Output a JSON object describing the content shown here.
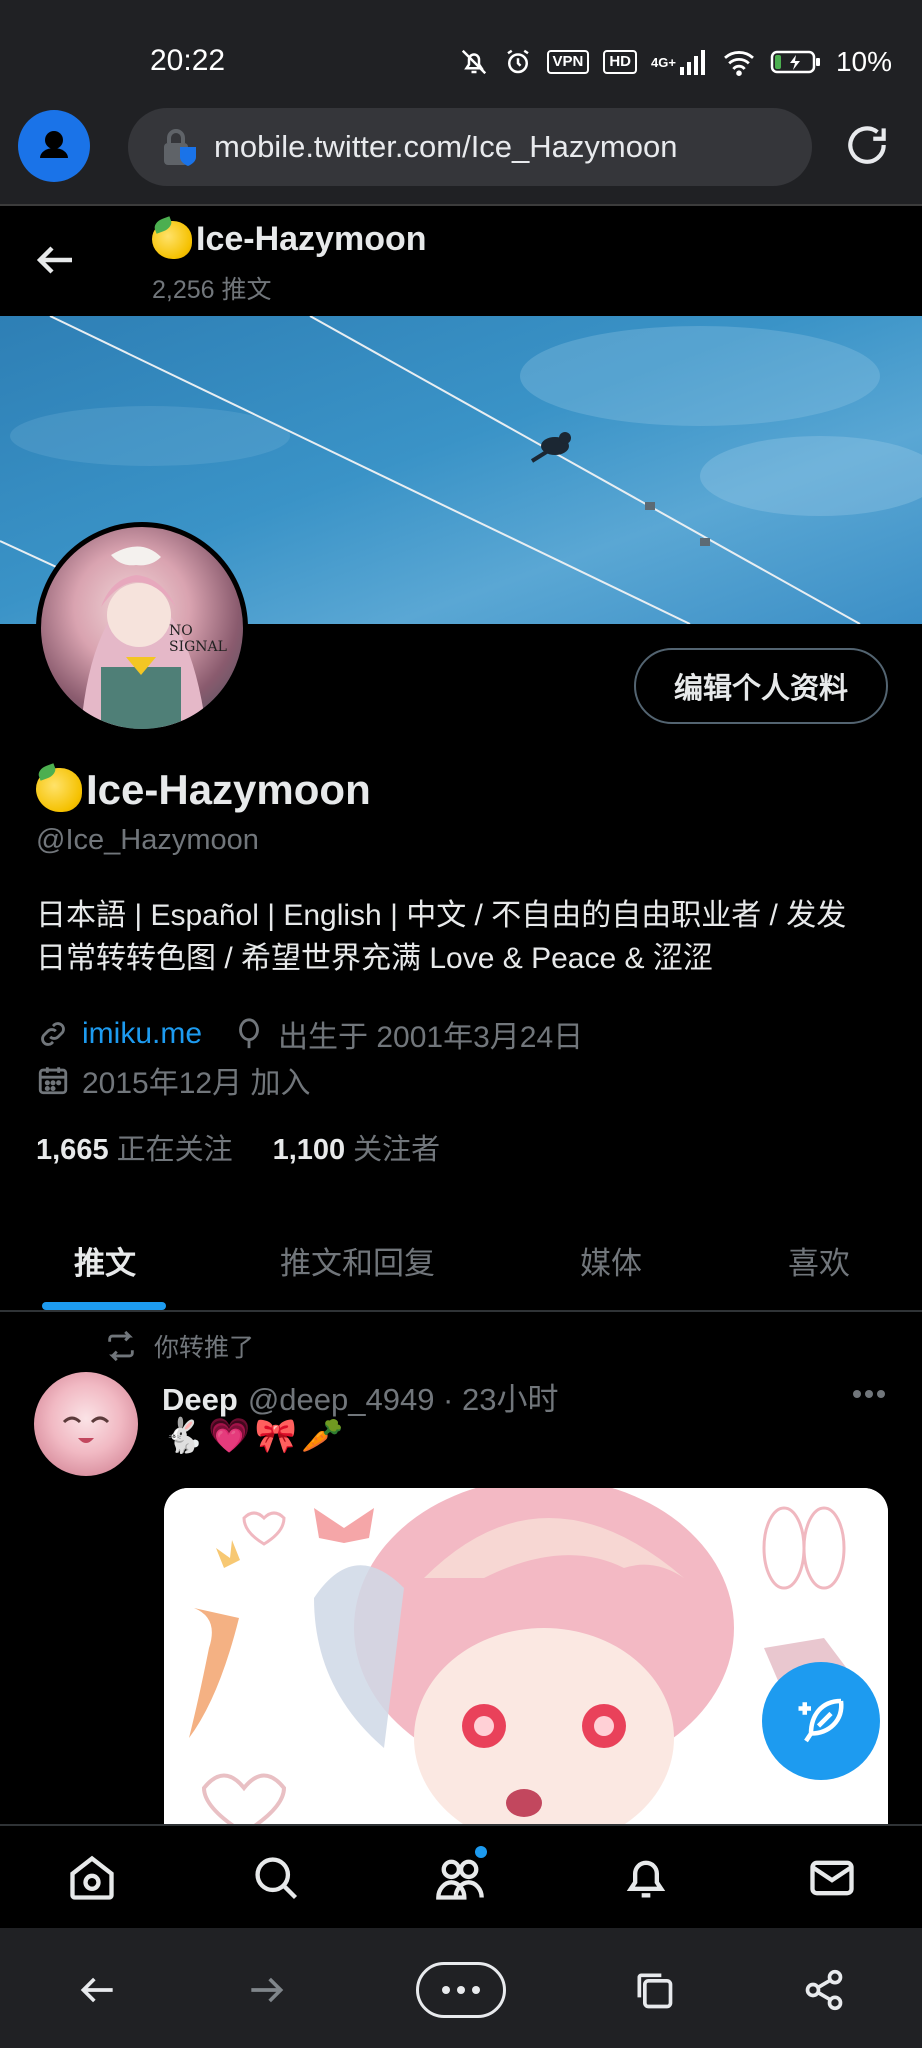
{
  "status_bar": {
    "time": "20:22",
    "vpn": "VPN",
    "hd": "HD",
    "network": "4G+",
    "battery": "10%",
    "icons": [
      "mute-icon",
      "alarm-icon",
      "vpn-icon",
      "hd-icon",
      "signal-icon",
      "wifi-icon",
      "battery-icon"
    ]
  },
  "browser": {
    "url": "mobile.twitter.com/Ice_Hazymoon",
    "icons": [
      "account-icon",
      "lock-icon",
      "reload-icon"
    ]
  },
  "header": {
    "name": "Ice-Hazymoon",
    "tweet_count": "2,256 推文"
  },
  "profile": {
    "edit_button": "编辑个人资料",
    "avatar_text": "NO SIGNAL",
    "name": "Ice-Hazymoon",
    "handle": "@Ice_Hazymoon",
    "bio_line1": "日本語 | Español | English | 中文 / 不自由的自由职业者 / 发发",
    "bio_line2": "日常转转色图 / 希望世界充满 Love & Peace & 涩涩",
    "website": "imiku.me",
    "birthday": "出生于 2001年3月24日",
    "joined": "2015年12月 加入",
    "following_count": "1,665",
    "following_label": "正在关注",
    "followers_count": "1,100",
    "followers_label": "关注者"
  },
  "tabs": [
    {
      "label": "推文",
      "active": true
    },
    {
      "label": "推文和回复",
      "active": false
    },
    {
      "label": "媒体",
      "active": false
    },
    {
      "label": "喜欢",
      "active": false
    }
  ],
  "tweet": {
    "retweet_label": "你转推了",
    "author_name": "Deep",
    "author_meta": "@deep_4949 · 23小时",
    "emoji": [
      "🐇",
      "💗",
      "🎀",
      "🥕"
    ]
  },
  "colors": {
    "accent": "#1d9bf0",
    "muted": "#71767b",
    "text": "#e7e9ea",
    "background": "#000000",
    "chrome": "#202124"
  }
}
